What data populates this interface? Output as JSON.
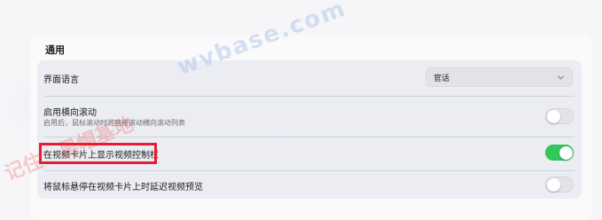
{
  "section": {
    "title": "通用"
  },
  "settings": [
    {
      "label": "界面语言",
      "control": "select",
      "value": "官话"
    },
    {
      "label": "启用横向滚动",
      "description": "启用后，鼠标滚动时将直接滚动横向滚动列表",
      "control": "toggle",
      "on": false
    },
    {
      "label": "在视频卡片上显示视频控制栏",
      "control": "toggle",
      "on": true,
      "highlighted": true
    },
    {
      "label": "将鼠标悬停在视频卡片上时延迟视频预览",
      "control": "toggle",
      "on": false
    }
  ],
  "watermarks": [
    "记住：黑帽基地",
    "wvbase.com"
  ],
  "colors": {
    "toggle_on": "#34c759",
    "toggle_off": "#e4e4e8",
    "highlight_box": "#e81c30"
  },
  "icons": {
    "select_chevron": "chevron-down-icon"
  }
}
